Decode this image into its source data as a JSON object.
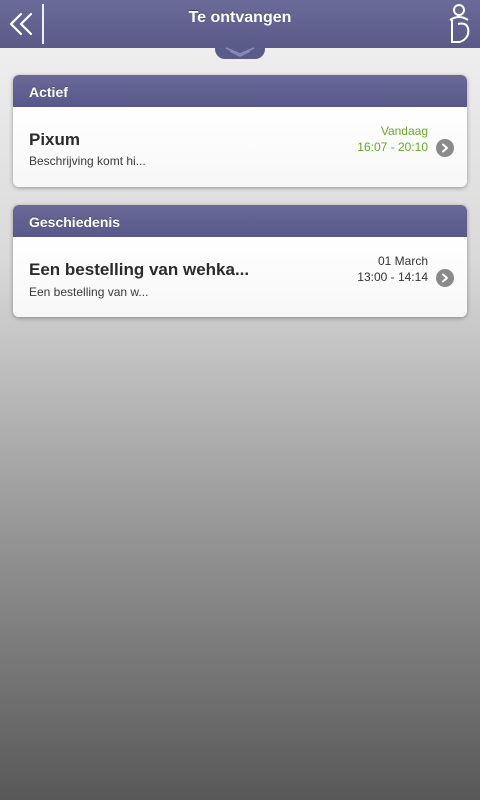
{
  "header": {
    "title": "Te ontvangen",
    "back_icon": "double-chevron-left-icon",
    "logo_icon": "app-logo-icon"
  },
  "active_section": {
    "title": "Actief",
    "items": [
      {
        "title": "Pixum",
        "subtitle": "Beschrijving komt hi...",
        "date": "Vandaag",
        "time": "16:07 - 20:10"
      }
    ]
  },
  "history_section": {
    "title": "Geschiedenis",
    "items": [
      {
        "title": "Een bestelling van wehka...",
        "subtitle": "Een bestelling van w...",
        "date": "01 March",
        "time": "13:00 - 14:14"
      }
    ]
  },
  "colors": {
    "header": "#5d5d8c",
    "active_time": "#6aa62a"
  }
}
